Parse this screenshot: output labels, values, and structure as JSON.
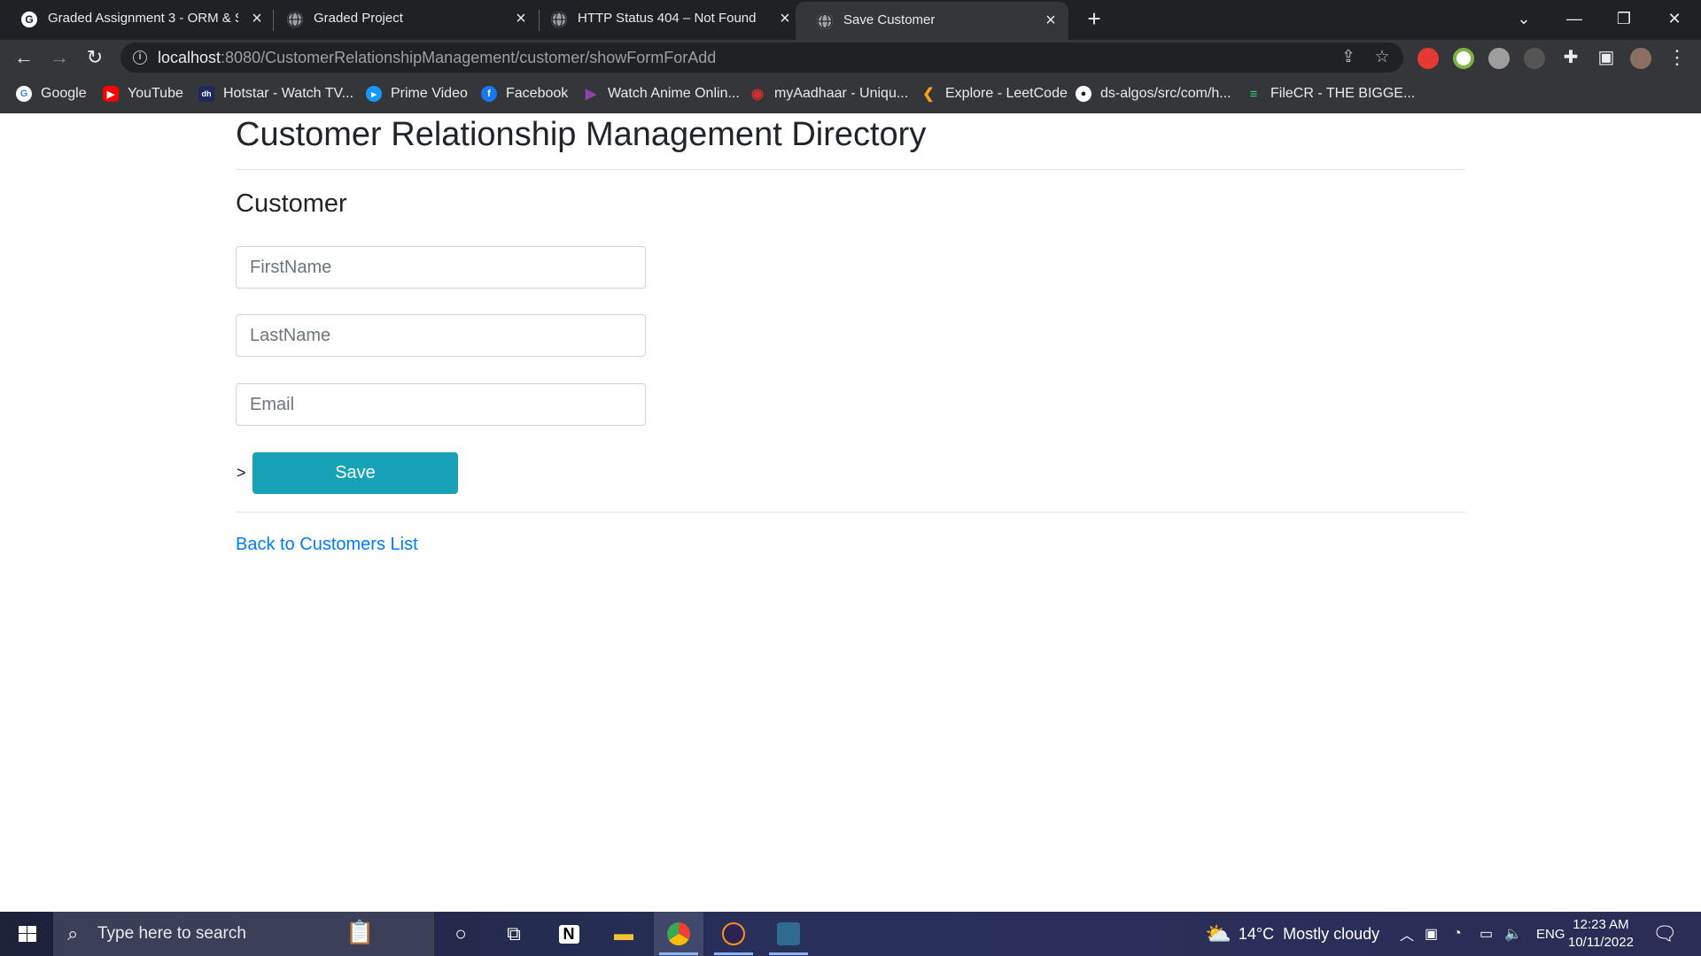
{
  "browser": {
    "tabs": [
      {
        "title": "Graded Assignment 3 - ORM & S",
        "icon": "google-g-icon",
        "active": false
      },
      {
        "title": "Graded Project",
        "icon": "globe-icon",
        "active": false
      },
      {
        "title": "HTTP Status 404 – Not Found",
        "icon": "globe-icon",
        "active": false
      },
      {
        "title": "Save Customer",
        "icon": "globe-icon",
        "active": true
      }
    ],
    "url_host": "localhost",
    "url_path": ":8080/CustomerRelationshipManagement/customer/showFormForAdd",
    "bookmarks": [
      {
        "label": "Google",
        "icon": "google-icon",
        "color": "#4285f4"
      },
      {
        "label": "YouTube",
        "icon": "youtube-icon",
        "color": "#ff0000"
      },
      {
        "label": "Hotstar - Watch TV...",
        "icon": "hotstar-icon",
        "color": "#1f2a5c"
      },
      {
        "label": "Prime Video",
        "icon": "prime-video-icon",
        "color": "#1399ff"
      },
      {
        "label": "Facebook",
        "icon": "facebook-icon",
        "color": "#1877f2"
      },
      {
        "label": "Watch Anime Onlin...",
        "icon": "anime-icon",
        "color": "#8e44ad"
      },
      {
        "label": "myAadhaar - Uniqu...",
        "icon": "aadhaar-icon",
        "color": "#d32f2f"
      },
      {
        "label": "Explore - LeetCode",
        "icon": "leetcode-icon",
        "color": "#f89f1b"
      },
      {
        "label": "ds-algos/src/com/h...",
        "icon": "github-icon",
        "color": "#ffffff"
      },
      {
        "label": "FileCR - THE BIGGE...",
        "icon": "filecr-icon",
        "color": "#2ecc71"
      }
    ]
  },
  "page": {
    "heading": "Customer Relationship Management Directory",
    "subheading": "Customer",
    "form": {
      "first_name_placeholder": "FirstName",
      "last_name_placeholder": "LastName",
      "email_placeholder": "Email",
      "stray_text": ">",
      "save_label": "Save"
    },
    "back_link": "Back to Customers List"
  },
  "taskbar": {
    "search_placeholder": "Type here to search",
    "weather_temp": "14°C",
    "weather_desc": "Mostly cloudy",
    "language": "ENG",
    "time": "12:23 AM",
    "date": "10/11/2022"
  },
  "colors": {
    "save_button": "#17a2b8",
    "link": "#007bff",
    "chrome_dark": "#202124",
    "chrome_toolbar": "#35363a"
  }
}
